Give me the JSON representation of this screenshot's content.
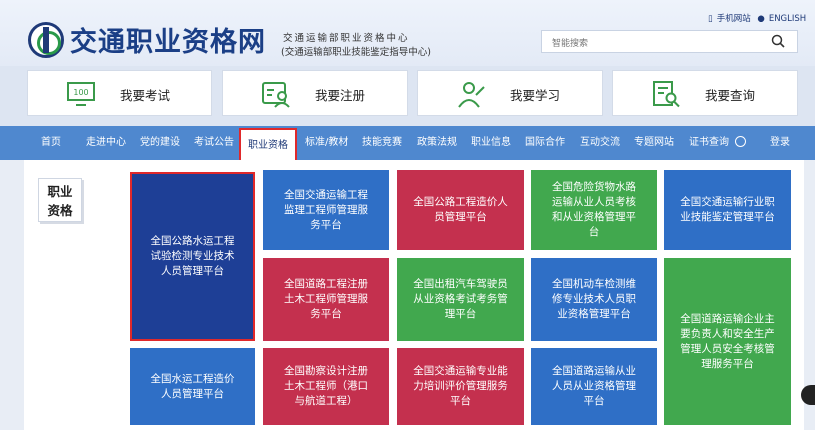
{
  "header": {
    "title": "交通职业资格网",
    "subtitle_line1": "交通运输部职业资格中心",
    "subtitle_line2": "(交通运输部职业技能鉴定指导中心)",
    "top_links": [
      "手机网站",
      "ENGLISH"
    ],
    "search": {
      "placeholder": "智能搜索"
    }
  },
  "quick_actions": [
    {
      "label": "我要考试",
      "icon": "monitor-100-icon"
    },
    {
      "label": "我要注册",
      "icon": "id-card-person-icon"
    },
    {
      "label": "我要学习",
      "icon": "student-icon"
    },
    {
      "label": "我要查询",
      "icon": "document-search-icon"
    }
  ],
  "nav": {
    "items": [
      "首页",
      "走进中心",
      "党的建设",
      "考试公告",
      "职业资格",
      "标准/教材",
      "技能竞赛",
      "政策法规",
      "职业信息",
      "国际合作",
      "互动交流",
      "专题网站",
      "证书查询"
    ],
    "active": "职业资格",
    "login": "登录"
  },
  "side_label": {
    "line1": "职业",
    "line2": "资格"
  },
  "colors": {
    "blue": "#2f6fc6",
    "navy": "#1e3f96",
    "crimson": "#c4304e",
    "green": "#41a84e",
    "nav": "#4f88cf",
    "highlight": "#e0292b"
  },
  "tiles": [
    {
      "text": "全国公路水运工程试验检测专业技术人员管理平台",
      "color": "navy",
      "highlighted": true
    },
    {
      "text": "全国交通运输工程监理工程师管理服务平台",
      "color": "blue"
    },
    {
      "text": "全国公路工程造价人员管理平台",
      "color": "crimson"
    },
    {
      "text": "全国危险货物水路运输从业人员考核和从业资格管理平台",
      "color": "green"
    },
    {
      "text": "全国交通运输行业职业技能鉴定管理平台",
      "color": "blue"
    },
    {
      "text": "全国道路工程注册土木工程师管理服务平台",
      "color": "crimson"
    },
    {
      "text": "全国出租汽车驾驶员从业资格考试考务管理平台",
      "color": "green"
    },
    {
      "text": "全国机动车检测维修专业技术人员职业资格管理平台",
      "color": "blue"
    },
    {
      "text": "全国道路运输企业主要负责人和安全生产管理人员安全考核管理服务平台",
      "color": "green"
    },
    {
      "text": "全国水运工程造价人员管理平台",
      "color": "blue"
    },
    {
      "text": "全国勘察设计注册土木工程师（港口与航道工程）",
      "color": "crimson"
    },
    {
      "text": "全国交通运输专业能力培训评价管理服务平台",
      "color": "crimson"
    },
    {
      "text": "全国道路运输从业人员从业资格管理平台",
      "color": "blue"
    }
  ]
}
